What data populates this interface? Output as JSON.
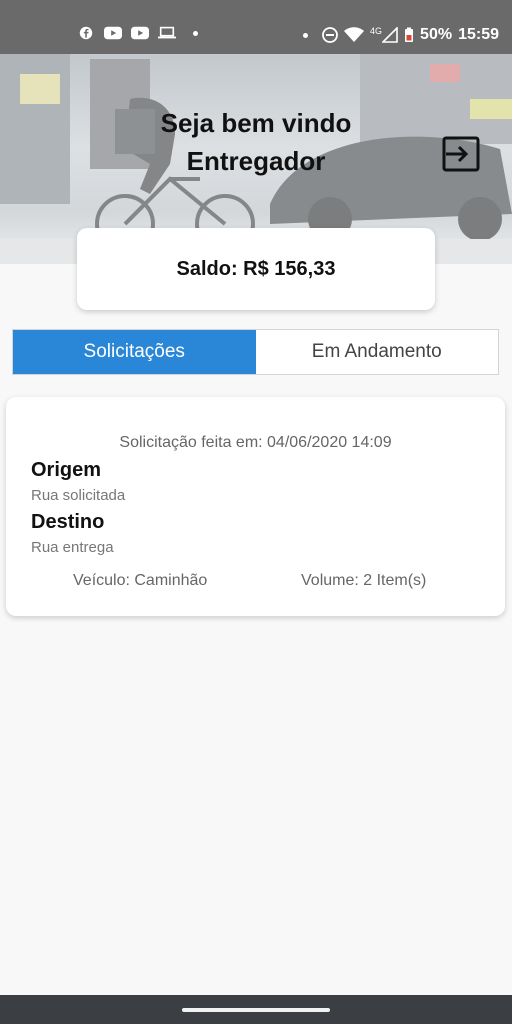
{
  "status_bar": {
    "battery": "50%",
    "time": "15:59",
    "network": "4G",
    "icons_left": [
      "facebook-icon",
      "youtube-icon",
      "youtube-icon",
      "laptop-icon",
      "dot"
    ],
    "icons_right": [
      "dot",
      "do-not-disturb-icon",
      "wifi-icon",
      "signal-icon",
      "battery-icon"
    ]
  },
  "header": {
    "title_line1": "Seja bem vindo",
    "title_line2": "Entregador",
    "logout_icon": "exit-to-app-icon"
  },
  "balance": {
    "text": "Saldo: R$ 156,33"
  },
  "tabs": [
    {
      "label": "Solicitações",
      "active": true
    },
    {
      "label": "Em Andamento",
      "active": false
    }
  ],
  "request": {
    "date_text": "Solicitação feita em: 04/06/2020 14:09",
    "origin_label": "Origem",
    "origin_value": "Rua solicitada",
    "destination_label": "Destino",
    "destination_value": "Rua entrega",
    "vehicle": "Veículo: Caminhão",
    "volume": "Volume: 2 Item(s)"
  },
  "colors": {
    "accent": "#2a87d8",
    "status_bar": "#6a6a6a",
    "nav_bar": "#3b3f44",
    "background": "#f8f8f8"
  }
}
